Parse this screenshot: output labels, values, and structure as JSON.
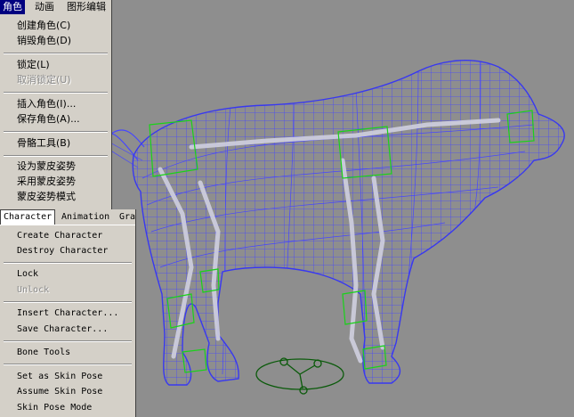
{
  "cn_menu": {
    "menubar": [
      "角色",
      "动画",
      "图形编辑"
    ],
    "items": [
      {
        "label": "创建角色(C)",
        "enabled": true
      },
      {
        "label": "销毁角色(D)",
        "enabled": true
      },
      {
        "label": "锁定(L)",
        "enabled": true
      },
      {
        "label": "取消锁定(U)",
        "enabled": false
      },
      {
        "label": "插入角色(I)...",
        "enabled": true
      },
      {
        "label": "保存角色(A)...",
        "enabled": true
      },
      {
        "label": "骨骼工具(B)",
        "enabled": true
      },
      {
        "label": "设为蒙皮姿势",
        "enabled": true
      },
      {
        "label": "采用蒙皮姿势",
        "enabled": true
      },
      {
        "label": "蒙皮姿势模式",
        "enabled": true
      }
    ]
  },
  "en_menu": {
    "menubar": [
      "Character",
      "Animation",
      "Gra"
    ],
    "items": [
      {
        "label": "Create Character",
        "enabled": true
      },
      {
        "label": "Destroy Character",
        "enabled": true
      },
      {
        "label": "Lock",
        "enabled": true
      },
      {
        "label": "Unlock",
        "enabled": false
      },
      {
        "label": "Insert Character...",
        "enabled": true
      },
      {
        "label": "Save Character...",
        "enabled": true
      },
      {
        "label": "Bone Tools",
        "enabled": true
      },
      {
        "label": "Set as Skin Pose",
        "enabled": true
      },
      {
        "label": "Assume Skin Pose",
        "enabled": true
      },
      {
        "label": "Skin Pose Mode",
        "enabled": true
      }
    ]
  },
  "viewport": {
    "background": "#8e8e8e",
    "mesh_color": "#4040ff",
    "bone_color": "#c8c8d8",
    "helper_color": "#00c800",
    "character_icon_color": "#0a5a0a"
  }
}
